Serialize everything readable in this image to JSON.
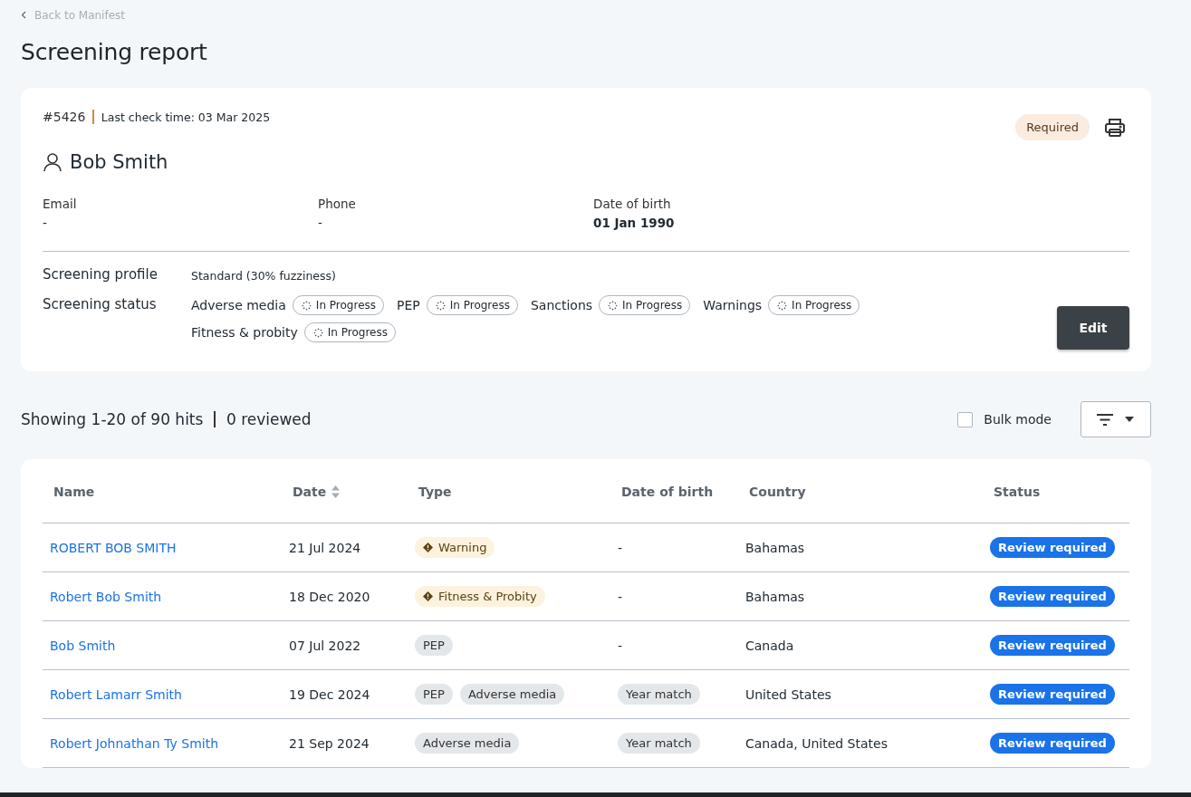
{
  "back_link": "Back to Manifest",
  "title": "Screening report",
  "profile": {
    "id": "#5426",
    "last_check": "Last check time: 03 Mar 2025",
    "badge": "Required",
    "name": "Bob Smith",
    "fields": [
      {
        "label": "Email",
        "value": "-"
      },
      {
        "label": "Phone",
        "value": "-"
      },
      {
        "label": "Date of birth",
        "value": "01 Jan 1990"
      }
    ],
    "screening_profile": {
      "label": "Screening profile",
      "value": "Standard (30% fuzziness)"
    },
    "screening_status": {
      "label": "Screening status",
      "items": [
        {
          "name": "Adverse media",
          "status": "In Progress"
        },
        {
          "name": "PEP",
          "status": "In Progress"
        },
        {
          "name": "Sanctions",
          "status": "In Progress"
        },
        {
          "name": "Warnings",
          "status": "In Progress"
        },
        {
          "name": "Fitness & probity",
          "status": "In Progress"
        }
      ]
    },
    "edit_button": "Edit"
  },
  "hits": {
    "summary": "Showing 1-20 of 90 hits",
    "reviewed": "0 reviewed",
    "bulk_mode": {
      "label": "Bulk mode",
      "checked": false
    }
  },
  "table": {
    "columns": [
      {
        "label": "Name",
        "sortable": false
      },
      {
        "label": "Date",
        "sortable": true
      },
      {
        "label": "Type",
        "sortable": false
      },
      {
        "label": "Date of birth",
        "sortable": false
      },
      {
        "label": "Country",
        "sortable": false
      },
      {
        "label": "Status",
        "sortable": false
      }
    ],
    "rows": [
      {
        "name": "ROBERT BOB SMITH",
        "date": "21 Jul 2024",
        "types": [
          {
            "label": "Warning",
            "kind": "warning"
          }
        ],
        "dob": [
          {
            "label": "-",
            "kind": "text"
          }
        ],
        "country": "Bahamas",
        "status": "Review required"
      },
      {
        "name": "Robert Bob Smith",
        "date": "18 Dec 2020",
        "types": [
          {
            "label": "Fitness & Probity",
            "kind": "warning"
          }
        ],
        "dob": [
          {
            "label": "-",
            "kind": "text"
          }
        ],
        "country": "Bahamas",
        "status": "Review required"
      },
      {
        "name": "Bob Smith",
        "date": "07 Jul 2022",
        "types": [
          {
            "label": "PEP",
            "kind": "plain"
          }
        ],
        "dob": [
          {
            "label": "-",
            "kind": "text"
          }
        ],
        "country": "Canada",
        "status": "Review required"
      },
      {
        "name": "Robert Lamarr Smith",
        "date": "19 Dec 2024",
        "types": [
          {
            "label": "PEP",
            "kind": "plain"
          },
          {
            "label": "Adverse media",
            "kind": "plain"
          }
        ],
        "dob": [
          {
            "label": "Year match",
            "kind": "tag"
          }
        ],
        "country": "United States",
        "status": "Review required"
      },
      {
        "name": "Robert Johnathan Ty Smith",
        "date": "21 Sep 2024",
        "types": [
          {
            "label": "Adverse media",
            "kind": "plain"
          }
        ],
        "dob": [
          {
            "label": "Year match",
            "kind": "tag"
          }
        ],
        "country": "Canada, United States",
        "status": "Review required"
      }
    ]
  }
}
